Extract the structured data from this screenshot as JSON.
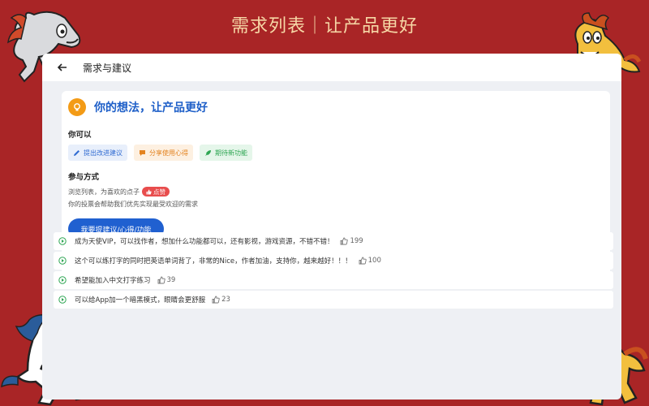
{
  "banner": {
    "title": "需求列表｜让产品更好"
  },
  "nav": {
    "title": "需求与建议",
    "back_icon": "arrow-left-icon"
  },
  "card": {
    "headline": "你的想法，让产品更好",
    "can_label": "你可以",
    "chips": [
      {
        "label": "提出改进建议",
        "icon": "pencil-icon",
        "color": "#2f6bd2"
      },
      {
        "label": "分享使用心得",
        "icon": "chat-bubble-icon",
        "color": "#e38320"
      },
      {
        "label": "期待新功能",
        "icon": "rocket-icon",
        "color": "#2ea653"
      }
    ],
    "participate_label": "参与方式",
    "browse_text": "浏览列表，为喜欢的点子",
    "like_badge": "点赞",
    "vote_text": "你的投票会帮助我们优先实现最受欢迎的需求",
    "cta_label": "我要提建议/心得/功能"
  },
  "requests": [
    {
      "text": "成为天使VIP，可以找作者，想加什么功能都可以，还有影视，游戏资源，不错不错！",
      "votes": "199"
    },
    {
      "text": "这个可以练打字的同时把英语单词背了，非常的Nice，作者加油，支持你，越来越好！！！",
      "votes": "100"
    },
    {
      "text": "希望能加入中文打字练习",
      "votes": "39"
    },
    {
      "text": "可以给App加一个暗黑模式，眼睛会更舒服",
      "votes": "23"
    }
  ],
  "colors": {
    "background": "#a92526",
    "accent": "#2060d0",
    "banner_text": "#f6d7a6"
  }
}
